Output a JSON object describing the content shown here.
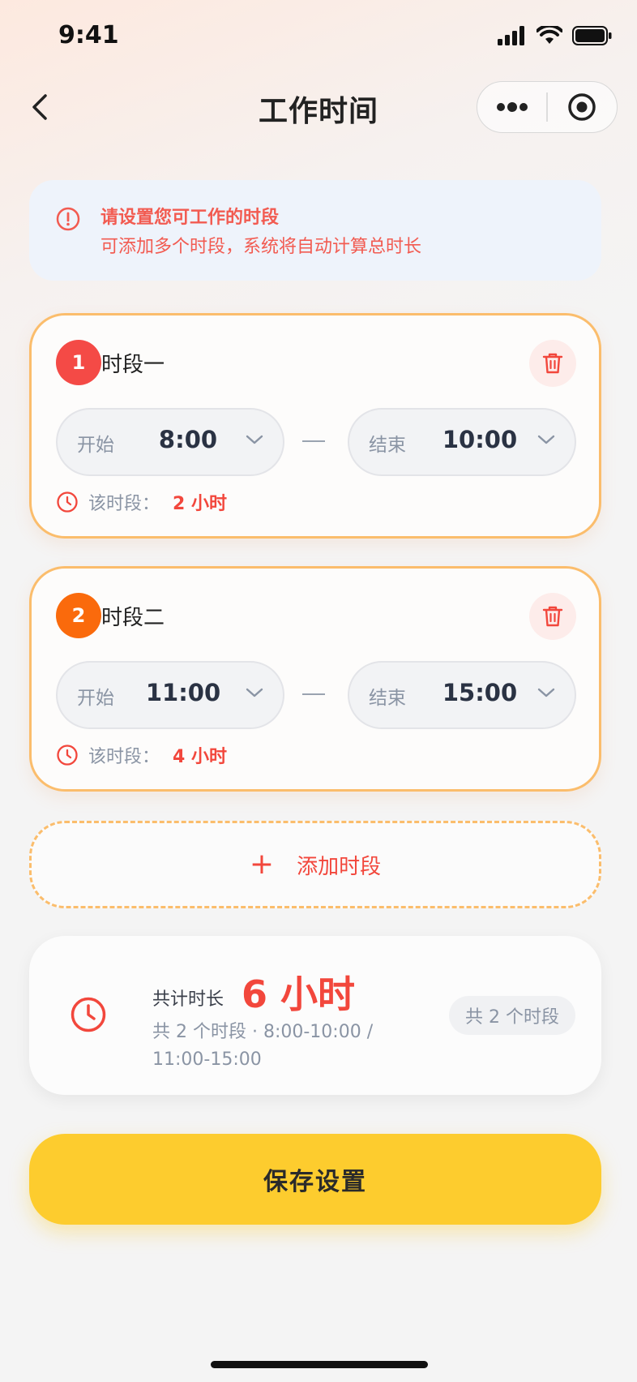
{
  "status_bar": {
    "time": "9:41"
  },
  "nav": {
    "title": "工作时间"
  },
  "notice": {
    "line1": "请设置您可工作的时段",
    "line2": "可添加多个时段，系统将自动计算总时长"
  },
  "periods": [
    {
      "index": "1",
      "title": "时段一",
      "badge_color": "#f44a46",
      "start_label": "开始",
      "start_value": "8:00",
      "end_label": "结束",
      "end_value": "10:00",
      "duration_label": "该时段：",
      "duration_value": "2 小时"
    },
    {
      "index": "2",
      "title": "时段二",
      "badge_color": "#fa6a0c",
      "start_label": "开始",
      "start_value": "11:00",
      "end_label": "结束",
      "end_value": "15:00",
      "duration_label": "该时段：",
      "duration_value": "4 小时"
    }
  ],
  "add_button": {
    "label": "添加时段"
  },
  "total": {
    "label": "共计时长",
    "value": "6 小时",
    "summary": "共 2 个时段 · 8:00-10:00 / 11:00-15:00",
    "count_badge": "共 2 个时段"
  },
  "save_button": {
    "label": "保存设置"
  },
  "colors": {
    "accent_red": "#f2473c",
    "card_border": "#fbbd6c",
    "save_yellow": "#fdcc2e",
    "notice_bg": "#eef3fb"
  }
}
